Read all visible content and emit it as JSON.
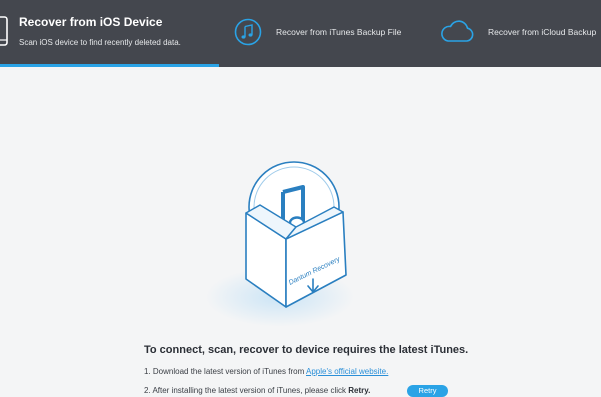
{
  "header": {
    "tabs": [
      {
        "title": "Recover from iOS Device",
        "subtitle": "Scan iOS device to find recently deleted data.",
        "icon": "phone-icon",
        "active": true
      },
      {
        "label": "Recover from iTunes Backup File",
        "icon": "itunes-music-icon"
      },
      {
        "label": "Recover from iCloud Backup",
        "icon": "cloud-icon"
      }
    ],
    "colors": {
      "background": "#44474e",
      "accent": "#2aa3e6"
    }
  },
  "illustration": {
    "box_label": "Dantum Recovery",
    "icon": "itunes-box-illustration"
  },
  "main": {
    "heading": "To connect, scan, recover to device requires the latest iTunes.",
    "step1_prefix": "1. Download the latest version of iTunes from ",
    "step1_link": "Apple's official website.",
    "step2_prefix": "2. After installing the latest version of iTunes, please click ",
    "step2_bold": "Retry.",
    "retry_label": "Retry"
  }
}
